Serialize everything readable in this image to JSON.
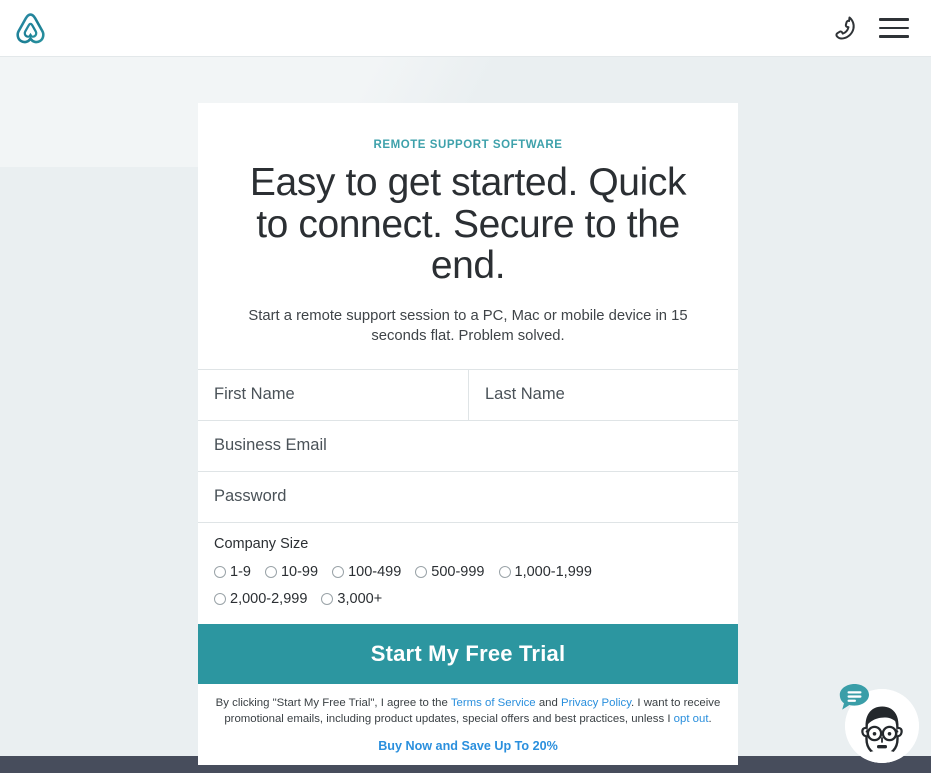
{
  "header": {
    "logo_icon": "splashtop-triangle-logo",
    "phone_icon": "phone-handset-icon",
    "menu_icon": "hamburger-menu-icon",
    "brand_color": "#1f7f93"
  },
  "card": {
    "eyebrow": "REMOTE SUPPORT SOFTWARE",
    "headline": "Easy to get started. Quick to connect. Secure to the end.",
    "subheadline": "Start a remote support session to a PC, Mac or mobile device in 15 seconds flat. Problem solved.",
    "accent_color": "#3ea1ab"
  },
  "form": {
    "fields": [
      {
        "name": "first-name",
        "placeholder": "First Name",
        "value": "",
        "type": "text"
      },
      {
        "name": "last-name",
        "placeholder": "Last Name",
        "value": "",
        "type": "text"
      },
      {
        "name": "business-email",
        "placeholder": "Business Email",
        "value": "",
        "type": "email"
      },
      {
        "name": "password",
        "placeholder": "Password",
        "value": "",
        "type": "password"
      }
    ],
    "company_size": {
      "label": "Company Size",
      "selected": "",
      "options": [
        "1-9",
        "10-99",
        "100-499",
        "500-999",
        "1,000-1,999",
        "2,000-2,999",
        "3,000+"
      ]
    },
    "submit_label": "Start My Free Trial",
    "submit_color": "#2c96a0"
  },
  "legal": {
    "prefix": "By clicking \"Start My Free Trial\", I agree to the ",
    "terms_link": "Terms of Service",
    "conjunction": " and ",
    "privacy_link": "Privacy Policy",
    "middle": ". I want to receive promotional emails, including product updates, special offers and best practices, unless I ",
    "optout_link": "opt out",
    "suffix": ".",
    "buy_now_link": "Buy Now and Save Up To 20%",
    "link_color": "#2a8fdd"
  },
  "chat_widget": {
    "avatar_icon": "support-agent-avatar-icon",
    "badge_icon": "chat-bubble-icon",
    "badge_color": "#3a9ea8"
  },
  "footer": {
    "strip_color": "#474d5c"
  }
}
